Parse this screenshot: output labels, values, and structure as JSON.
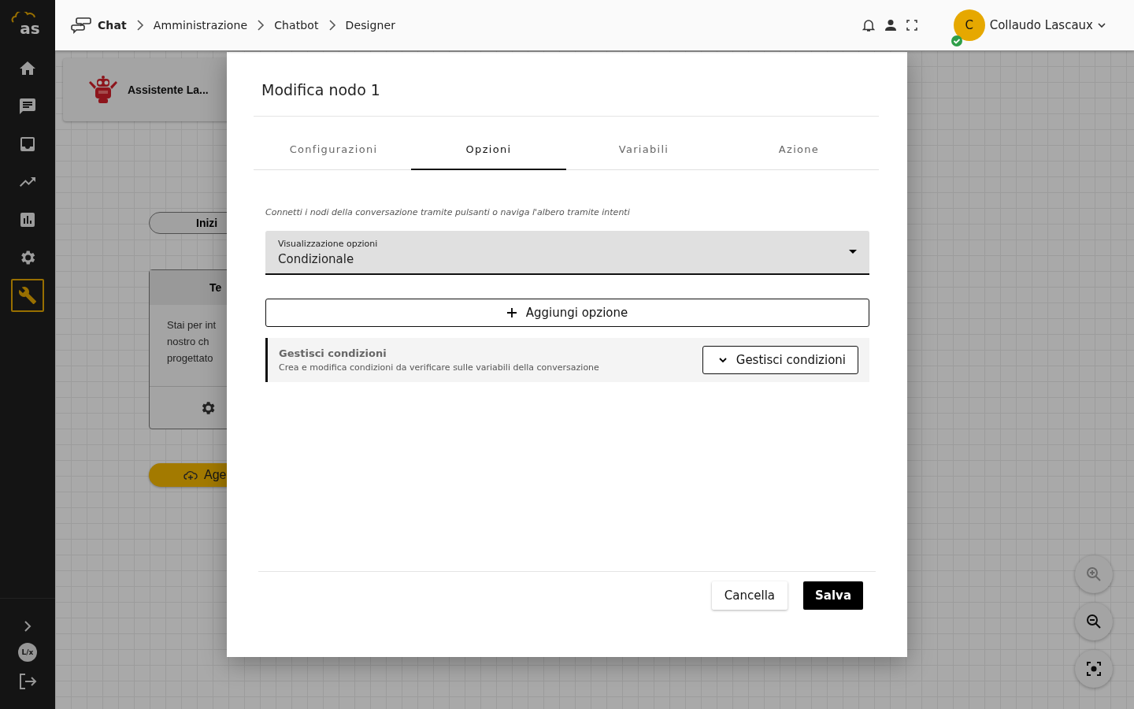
{
  "sidebar": {
    "items": [
      {
        "kind": "home",
        "selected": false
      },
      {
        "kind": "chat",
        "selected": false
      },
      {
        "kind": "inbox",
        "selected": false
      },
      {
        "kind": "trend",
        "selected": false
      },
      {
        "kind": "chart",
        "selected": false
      },
      {
        "kind": "gear",
        "selected": false
      },
      {
        "kind": "wrench",
        "selected": true
      }
    ],
    "logo_text": "as",
    "footer_badge": "L/x"
  },
  "breadcrumb": [
    "Chat",
    "Amministrazione",
    "Chatbot",
    "Designer"
  ],
  "user": {
    "initial": "C",
    "name": "Collaudo Lascaux",
    "online": true
  },
  "canvas": {
    "bot_name": "Assistente La...",
    "start_node": "Inizi",
    "node": {
      "title": "Te",
      "lines": [
        "Stai per int",
        "nostro ch",
        "progettato"
      ]
    },
    "agent_node": "Age",
    "zoom_controls": [
      {
        "kind": "zoom-in",
        "disabled": true
      },
      {
        "kind": "zoom-out",
        "disabled": false
      },
      {
        "kind": "fit",
        "disabled": false
      }
    ]
  },
  "dialog": {
    "title": "Modifica nodo 1",
    "tabs": [
      {
        "label": "Configurazioni",
        "selected": false
      },
      {
        "label": "Opzioni",
        "selected": true
      },
      {
        "label": "Variabili",
        "selected": false
      },
      {
        "label": "Azione",
        "selected": false
      }
    ],
    "hint": "Connetti i nodi della conversazione tramite pulsanti o naviga l'albero tramite intenti",
    "select": {
      "label": "Visualizzazione opzioni",
      "value": "Condizionale"
    },
    "add_button": "Aggiungi opzione",
    "conditions": {
      "title": "Gestisci condizioni",
      "description": "Crea e modifica condizioni da verificare sulle variabili della conversazione",
      "button": "Gestisci condizioni"
    },
    "buttons": {
      "cancel": "Cancella",
      "save": "Salva"
    }
  }
}
